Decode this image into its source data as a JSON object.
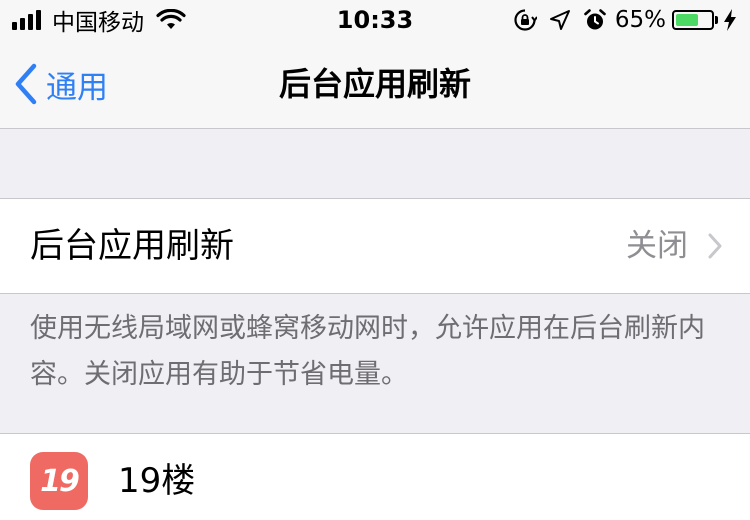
{
  "status_bar": {
    "carrier": "中国移动",
    "time": "10:33",
    "battery_percent_label": "65%",
    "battery_level": 0.65,
    "icons": [
      "signal-bars-icon",
      "wifi-icon",
      "orientation-lock-icon",
      "location-arrow-icon",
      "alarm-clock-icon",
      "battery-icon",
      "charging-bolt-icon"
    ]
  },
  "nav": {
    "back_label": "通用",
    "title": "后台应用刷新"
  },
  "setting": {
    "label": "后台应用刷新",
    "value": "关闭"
  },
  "footer_note": "使用无线局域网或蜂窝移动网时，允许应用在后台刷新内容。关闭应用有助于节省电量。",
  "apps": [
    {
      "icon_text": "19",
      "name": "19楼",
      "icon_color": "#ee6a63"
    }
  ],
  "colors": {
    "accent": "#2f7ff5",
    "battery_green": "#4cd964",
    "secondary_text": "#8e8e93",
    "group_background": "#efeff4"
  }
}
